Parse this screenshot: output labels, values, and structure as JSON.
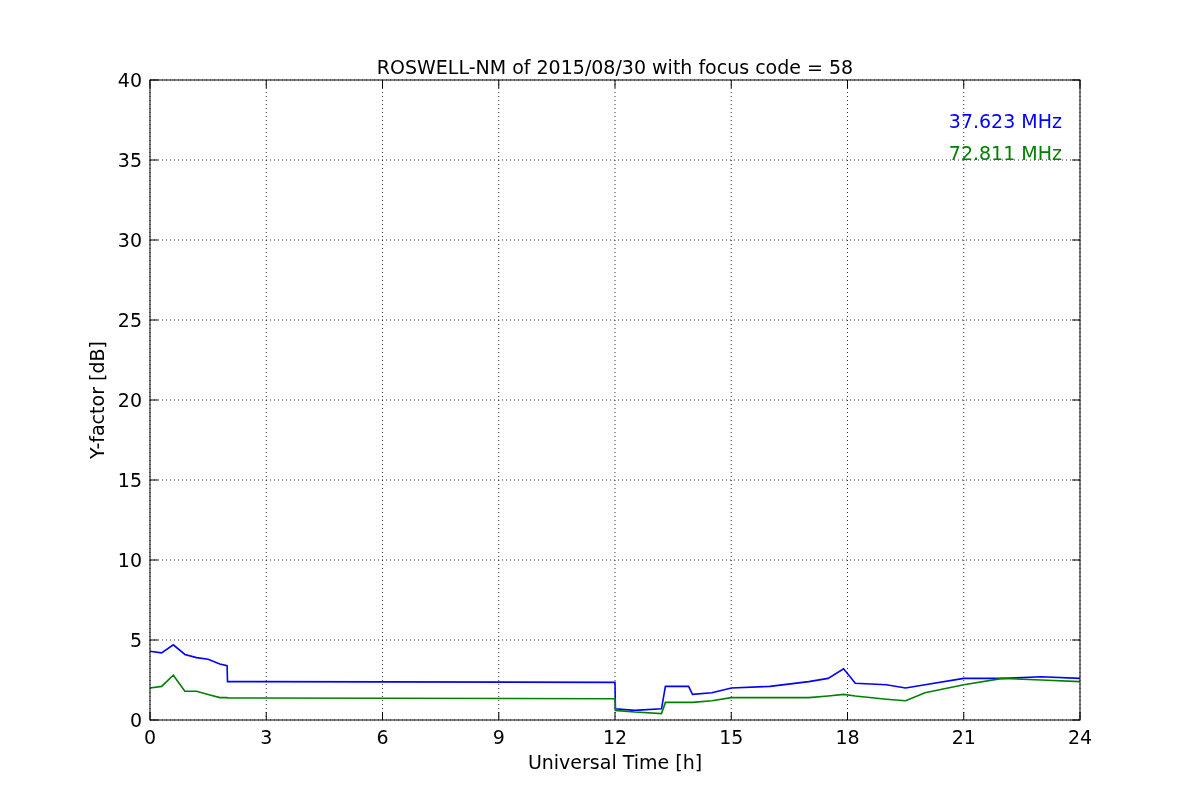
{
  "figure": {
    "chart_data": {
      "type": "line",
      "title": "ROSWELL-NM of 2015/08/30 with focus code = 58",
      "xlabel": "Universal Time [h]",
      "ylabel": "Y-factor [dB]",
      "x": [
        0,
        0.3,
        0.6,
        0.9,
        1.2,
        1.5,
        1.8,
        1.99,
        2.0,
        6,
        12,
        12.01,
        12.5,
        13.2,
        13.3,
        13.9,
        14.0,
        14.5,
        15,
        16,
        17,
        17.5,
        17.9,
        18.2,
        19,
        19.5,
        20,
        21,
        22,
        23,
        24
      ],
      "series": [
        {
          "name": "37.623 MHz",
          "color": "#0000ff",
          "values": [
            4.3,
            4.2,
            4.7,
            4.1,
            3.9,
            3.8,
            3.5,
            3.4,
            2.4,
            2.38,
            2.35,
            0.7,
            0.6,
            0.7,
            2.1,
            2.1,
            1.6,
            1.7,
            2.0,
            2.1,
            2.4,
            2.6,
            3.2,
            2.3,
            2.2,
            2.0,
            2.2,
            2.6,
            2.6,
            2.7,
            2.6
          ]
        },
        {
          "name": "72.811 MHz",
          "color": "#008000",
          "values": [
            2.0,
            2.1,
            2.8,
            1.8,
            1.8,
            1.6,
            1.4,
            1.4,
            1.38,
            1.36,
            1.33,
            0.6,
            0.5,
            0.4,
            1.1,
            1.1,
            1.1,
            1.2,
            1.4,
            1.4,
            1.4,
            1.5,
            1.6,
            1.5,
            1.3,
            1.2,
            1.7,
            2.2,
            2.6,
            2.5,
            2.4
          ]
        }
      ],
      "xlim": [
        0,
        24
      ],
      "ylim": [
        0,
        40
      ],
      "xticks": [
        0,
        3,
        6,
        9,
        12,
        15,
        18,
        21,
        24
      ],
      "yticks": [
        0,
        5,
        10,
        15,
        20,
        25,
        30,
        35,
        40
      ],
      "grid": true
    }
  }
}
